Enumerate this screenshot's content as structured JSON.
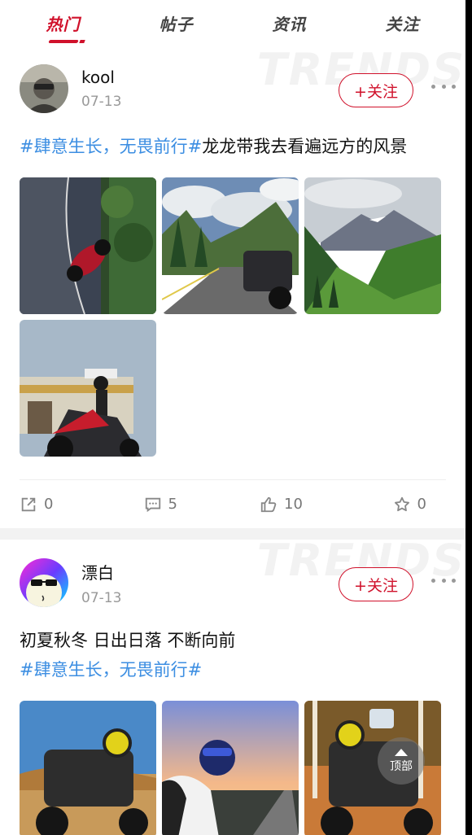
{
  "tabs": [
    {
      "label": "热门",
      "active": true
    },
    {
      "label": "帖子",
      "active": false
    },
    {
      "label": "资讯",
      "active": false
    },
    {
      "label": "关注",
      "active": false
    }
  ],
  "watermark": "TRENDS",
  "posts": [
    {
      "user": "kool",
      "date": "07-13",
      "follow_label": "+关注",
      "hashtag": "#肆意生长，无畏前行#",
      "text": "龙龙带我去看遍远方的风景",
      "images": [
        "motorcycle-on-curve-road",
        "mountain-road-motorcycle",
        "green-valley-mountains",
        "rider-with-motorcycle"
      ],
      "stats": {
        "share": "0",
        "comment": "5",
        "like": "10",
        "favorite": "0"
      }
    },
    {
      "user": "漂白",
      "date": "07-13",
      "follow_label": "+关注",
      "text_line1": "初夏秋冬 日出日落 不断向前",
      "hashtag": "#肆意生长，无畏前行#",
      "images": [
        "yellow-headlight-motorcycle",
        "rider-sunset-road",
        "motorcycle-autumn-forest"
      ]
    }
  ],
  "back_to_top": "顶部",
  "colors": {
    "accent": "#d0112b",
    "hashtag": "#3c8ee2"
  }
}
